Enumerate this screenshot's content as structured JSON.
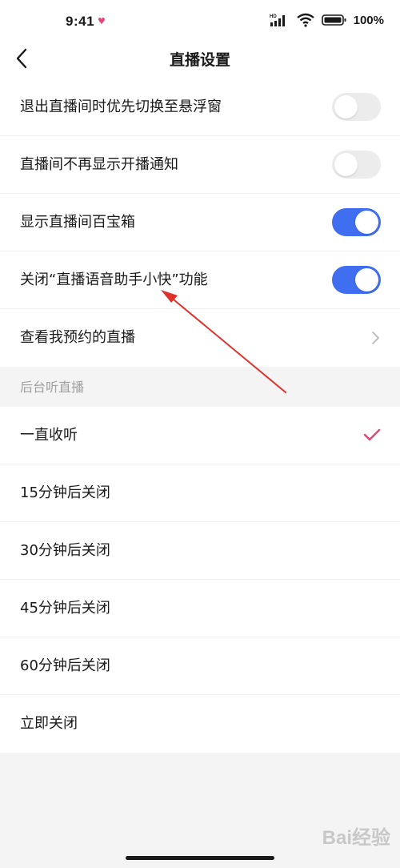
{
  "status_bar": {
    "time": "9:41",
    "heart": "♥",
    "network": "HD",
    "battery": "100%"
  },
  "header": {
    "title": "直播设置"
  },
  "settings": {
    "items": [
      {
        "label": "退出直播间时优先切换至悬浮窗",
        "control": "toggle",
        "on": false
      },
      {
        "label": "直播间不再显示开播通知",
        "control": "toggle",
        "on": false
      },
      {
        "label": "显示直播间百宝箱",
        "control": "toggle",
        "on": true
      },
      {
        "label": "关闭“直播语音助手小快”功能",
        "control": "toggle",
        "on": true
      },
      {
        "label": "查看我预约的直播",
        "control": "chevron"
      }
    ]
  },
  "background_listen": {
    "section_title": "后台听直播",
    "options": [
      {
        "label": "一直收听",
        "selected": true
      },
      {
        "label": "15分钟后关闭",
        "selected": false
      },
      {
        "label": "30分钟后关闭",
        "selected": false
      },
      {
        "label": "45分钟后关闭",
        "selected": false
      },
      {
        "label": "60分钟后关闭",
        "selected": false
      },
      {
        "label": "立即关闭",
        "selected": false
      }
    ]
  },
  "watermark": "Bai经验",
  "colors": {
    "accent_blue": "#3f6ef0",
    "check_pink": "#e2456f",
    "annotation_red": "#e0302a"
  }
}
